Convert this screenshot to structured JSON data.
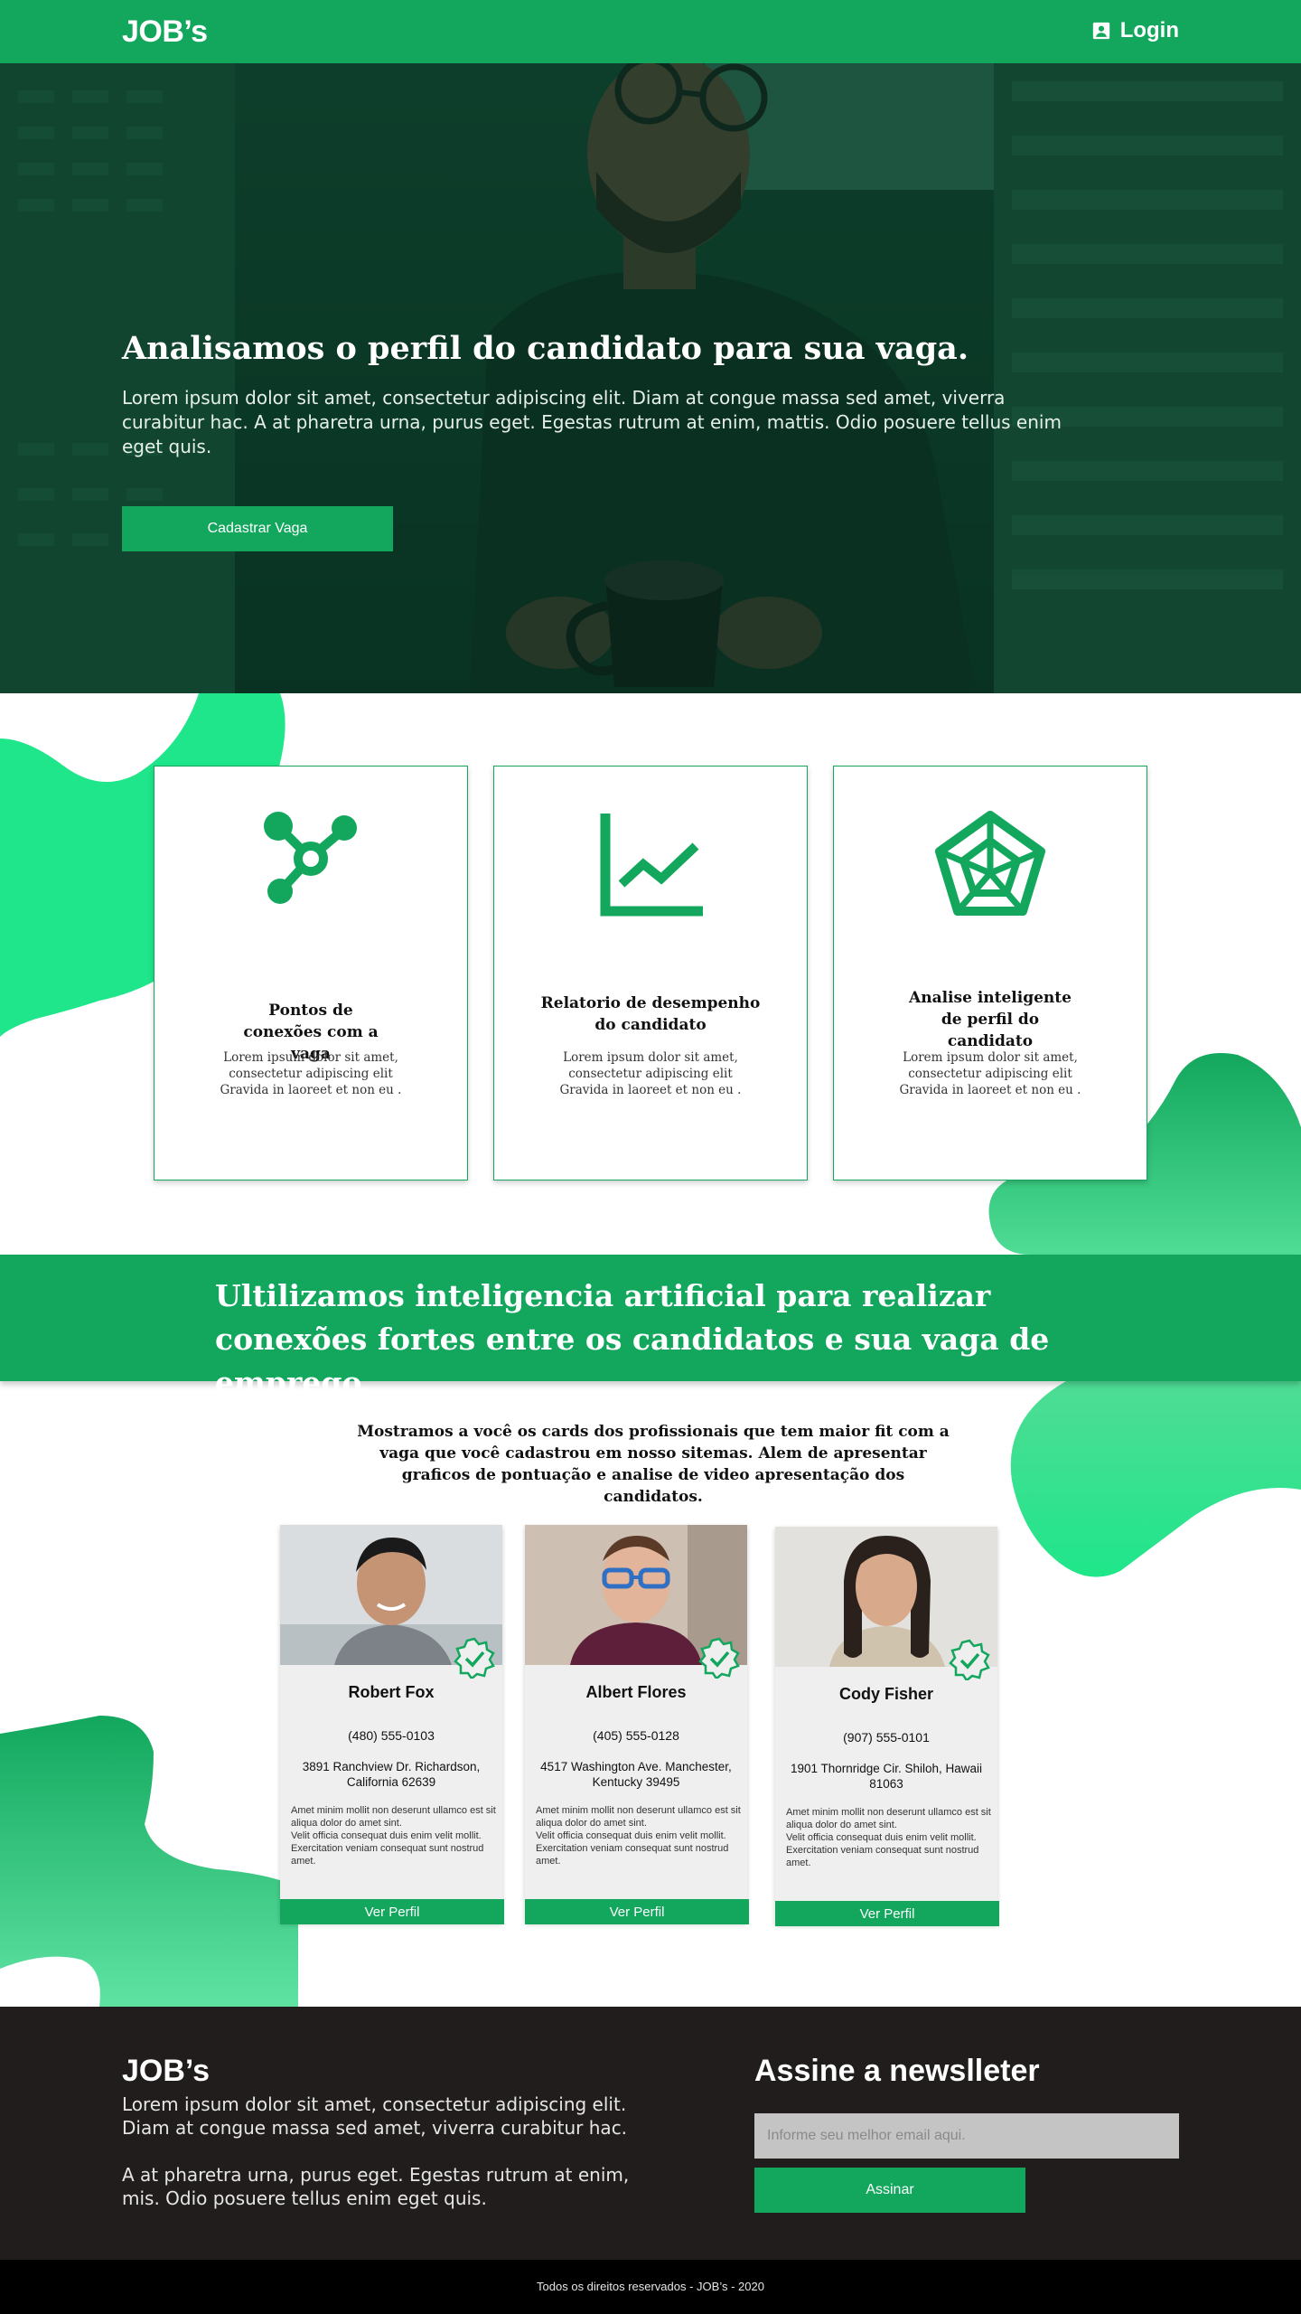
{
  "header": {
    "logo": "JOB’s",
    "login_label": "Login"
  },
  "hero": {
    "title": "Analisamos o perfil do candidato para sua vaga.",
    "text": "Lorem ipsum dolor sit amet, consectetur adipiscing elit. Diam at congue massa sed amet, viverra curabitur hac. A at pharetra urna, purus eget. Egestas rutrum at enim, mattis. Odio posuere tellus enim eget quis.",
    "button": "Cadastrar Vaga"
  },
  "features": [
    {
      "icon": "connections-icon",
      "title": "Pontos de conexões com a vaga",
      "text": "Lorem ipsum dolor sit amet, consectetur adipiscing elit Gravida in laoreet et non eu ."
    },
    {
      "icon": "chart-icon",
      "title": "Relatorio de desempenho do candidato",
      "text": "Lorem ipsum dolor sit amet, consectetur adipiscing elit Gravida in laoreet et non eu ."
    },
    {
      "icon": "radar-icon",
      "title": "Analise inteligente de perfil do candidato",
      "text": "Lorem ipsum dolor sit amet, consectetur adipiscing elit Gravida in laoreet et non eu ."
    }
  ],
  "band": {
    "text": "Ultilizamos inteligencia artificial para realizar conexões fortes entre os candidatos e sua vaga de emprego."
  },
  "candidates_intro": "Mostramos a você os cards dos profissionais que tem maior fit com a vaga que você cadastrou em nosso sitemas. Alem de apresentar graficos de pontuação e analise de video apresentação dos candidatos.",
  "candidates": [
    {
      "name": "Robert Fox",
      "phone": "(480) 555-0103",
      "address": "3891 Ranchview Dr. Richardson, California 62639",
      "desc": "Amet minim mollit non deserunt ullamco est sit aliqua dolor do amet sint.\nVelit officia consequat duis enim velit mollit. Exercitation veniam consequat sunt nostrud amet.",
      "button": "Ver Perfil",
      "badge": "verified-badge-icon"
    },
    {
      "name": "Albert Flores",
      "phone": "(405) 555-0128",
      "address": "4517 Washington Ave. Manchester, Kentucky 39495",
      "desc": "Amet minim mollit non deserunt ullamco est sit aliqua dolor do amet sint.\nVelit officia consequat duis enim velit mollit. Exercitation veniam consequat sunt nostrud amet.",
      "button": "Ver Perfil",
      "badge": "verified-badge-icon"
    },
    {
      "name": "Cody Fisher",
      "phone": "(907) 555-0101",
      "address": "1901 Thornridge Cir. Shiloh, Hawaii 81063",
      "desc": "Amet minim mollit non deserunt ullamco est sit aliqua dolor do amet sint.\nVelit officia consequat duis enim velit mollit. Exercitation veniam consequat sunt nostrud amet.",
      "button": "Ver Perfil",
      "badge": "verified-badge-icon"
    }
  ],
  "footer": {
    "logo": "JOB’s",
    "text": "Lorem ipsum dolor sit amet, consectetur adipiscing elit. Diam at congue massa sed amet, viverra curabitur hac.\n\nA at pharetra urna, purus eget. Egestas rutrum at enim, mis. Odio posuere tellus enim eget quis.",
    "newsletter_title": "Assine a newslleter",
    "email_placeholder": "Informe seu melhor email aqui.",
    "subscribe_button": "Assinar",
    "copyright": "Todos os direitos reservados - JOB’s - 2020"
  },
  "colors": {
    "brand_green": "#12a75d",
    "light_green": "#1fe68a",
    "footer_dark": "#211d1c"
  }
}
